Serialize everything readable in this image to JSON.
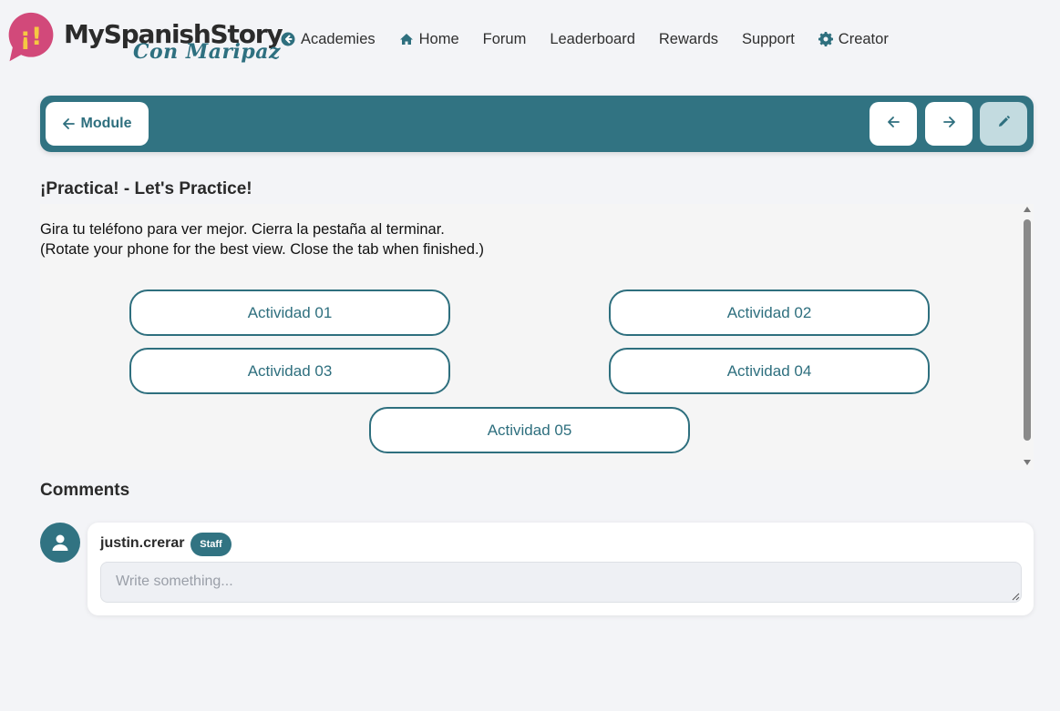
{
  "brand": {
    "badge_glyph": "¡!",
    "name": "MySpanishStory",
    "tagline": "Con Maripaz",
    "bubble_color": "#d2497a",
    "text_color": "#2e7080"
  },
  "nav": {
    "items": [
      {
        "label": "Academies",
        "icon": "circle-arrow-left-icon"
      },
      {
        "label": "Home",
        "icon": "home-icon"
      },
      {
        "label": "Forum",
        "icon": ""
      },
      {
        "label": "Leaderboard",
        "icon": ""
      },
      {
        "label": "Rewards",
        "icon": ""
      },
      {
        "label": "Support",
        "icon": ""
      },
      {
        "label": "Creator",
        "icon": "gear-icon"
      }
    ]
  },
  "toolbar": {
    "module_label": "Module",
    "prev_icon": "arrow-left-icon",
    "next_icon": "arrow-right-icon",
    "edit_icon": "pencil-icon",
    "accent": "#317382"
  },
  "lesson": {
    "title": "¡Practica! - Let's Practice!",
    "instructions_es": "Gira tu teléfono para ver mejor. Cierra la pestaña al terminar.",
    "instructions_en": "(Rotate your phone for the best view. Close the tab when finished.)",
    "activities": [
      "Actividad 01",
      "Actividad 02",
      "Actividad 03",
      "Actividad 04",
      "Actividad 05"
    ]
  },
  "comments": {
    "title": "Comments",
    "user": "justin.crerar",
    "role_badge": "Staff",
    "input_placeholder": "Write something..."
  }
}
